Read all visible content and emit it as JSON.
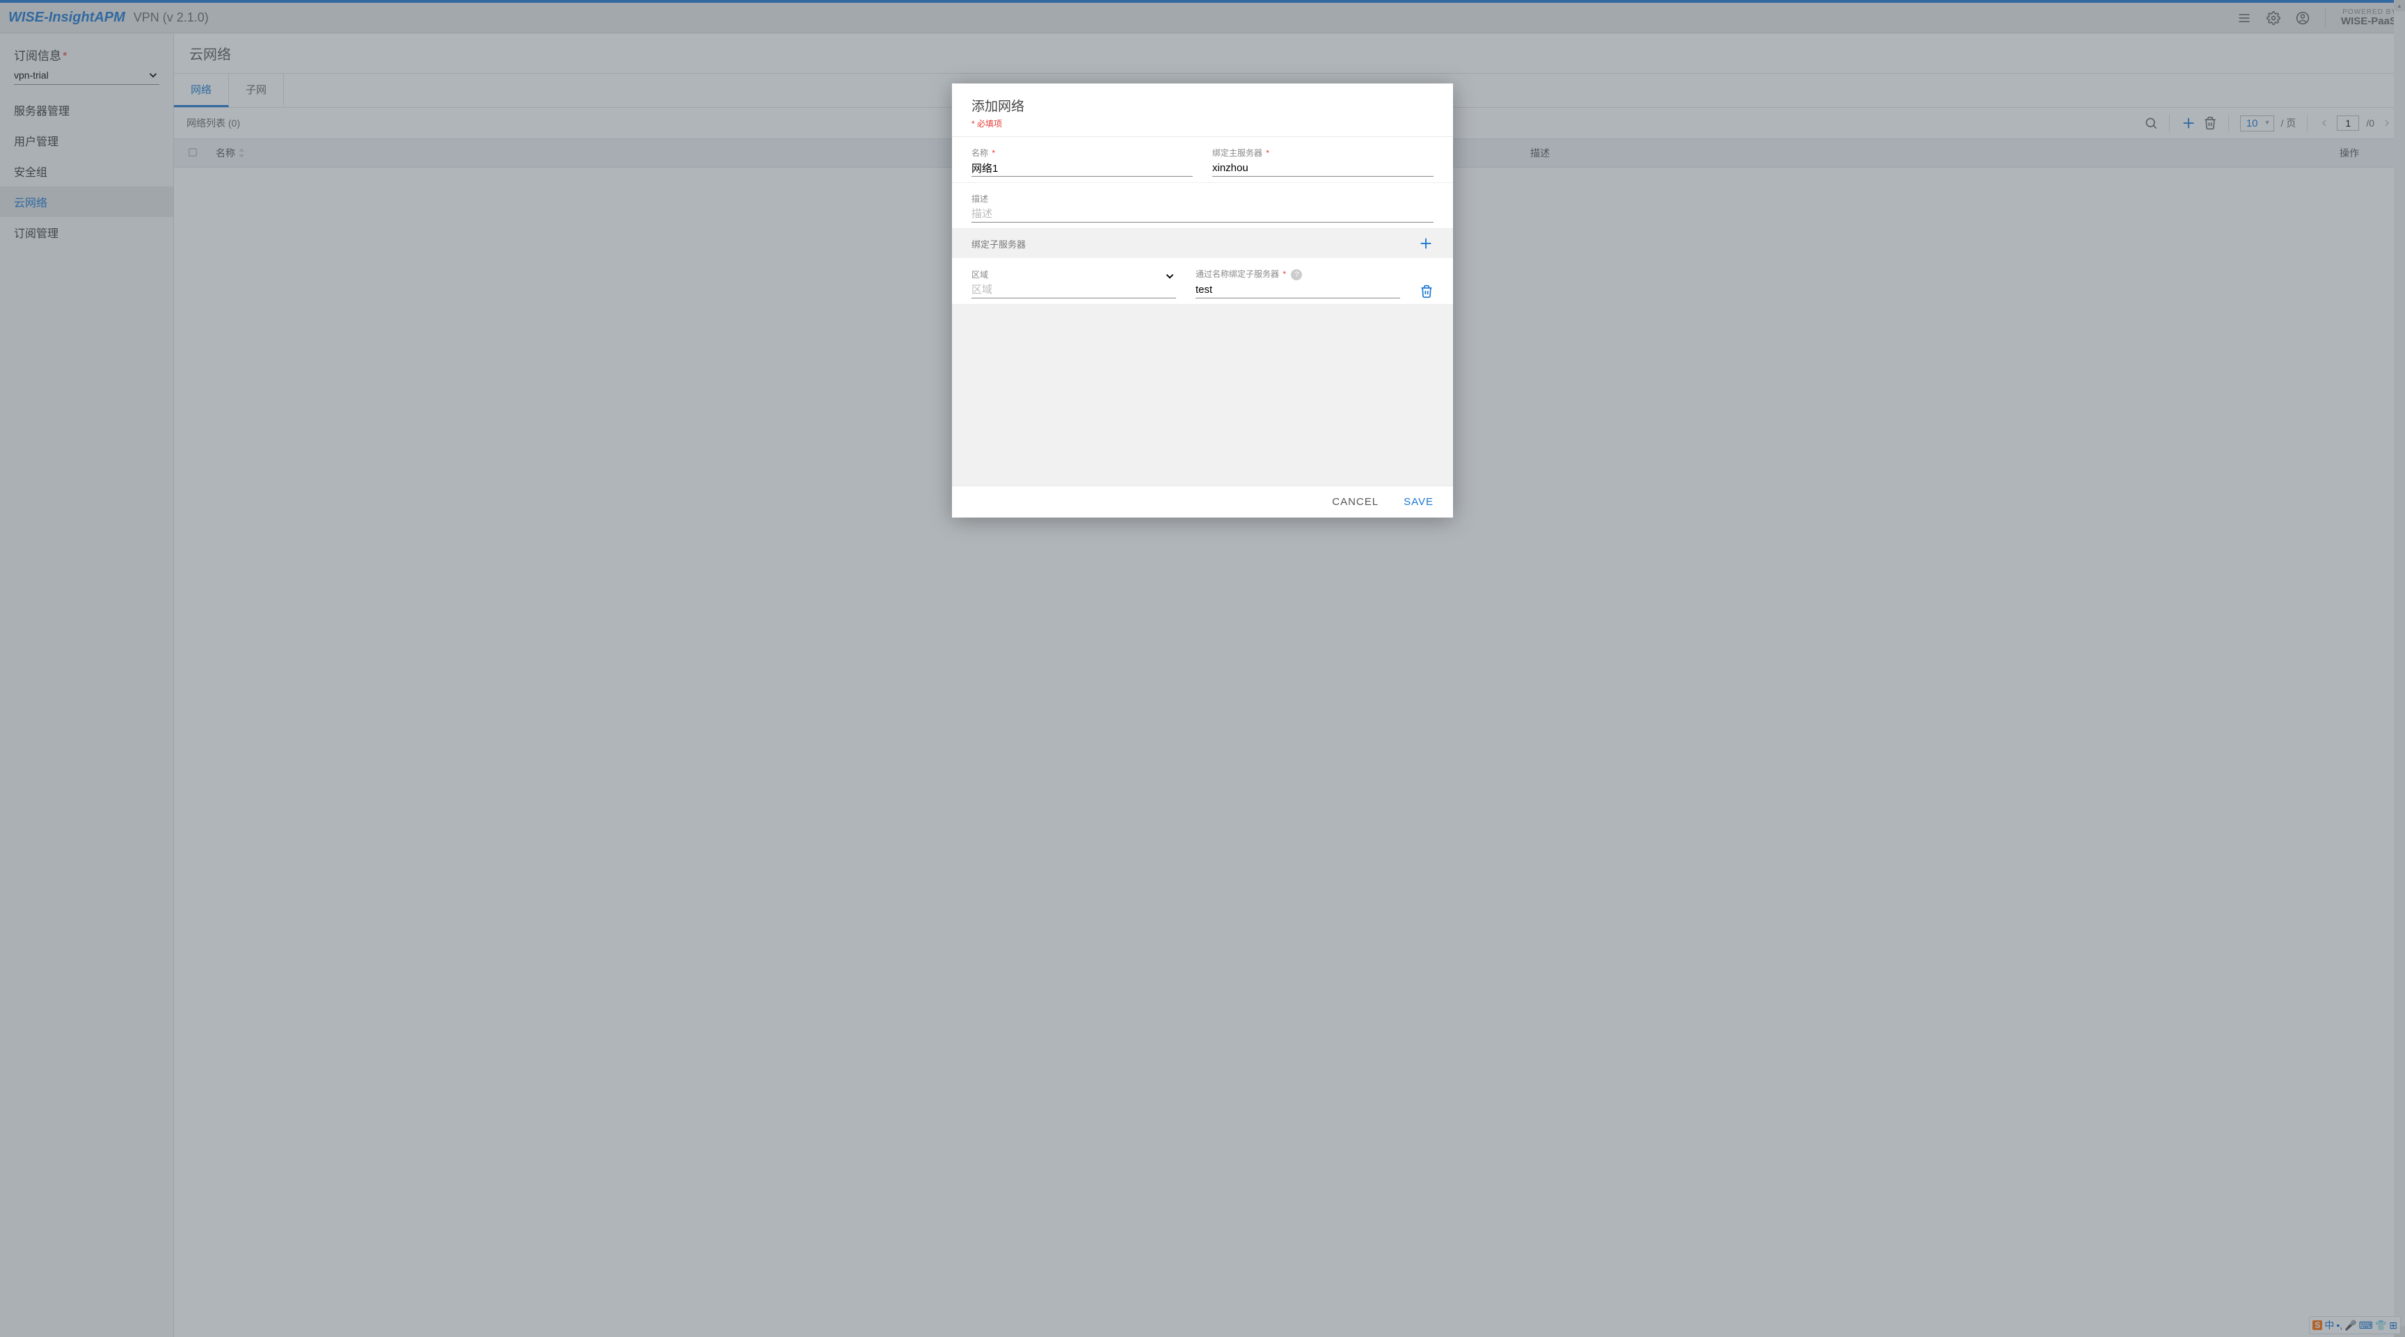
{
  "header": {
    "brand": "WISE-InsightAPM",
    "app": "VPN (v 2.1.0)",
    "powered_top": "POWERED BY",
    "powered_bottom": "WISE-PaaS"
  },
  "sidebar": {
    "sub_label": "订阅信息",
    "sub_value": "vpn-trial",
    "items": [
      "服务器管理",
      "用户管理",
      "安全组",
      "云网络",
      "订阅管理"
    ],
    "active_index": 3
  },
  "page": {
    "title": "云网络",
    "tabs": [
      "网络",
      "子网"
    ],
    "active_tab": 0,
    "list_label": "网络列表 (0)",
    "per_page": "10",
    "per_page_suffix": "/ 页",
    "page_current": "1",
    "page_total": "/0",
    "columns": {
      "name": "名称",
      "desc": "描述",
      "op": "操作"
    }
  },
  "dialog": {
    "title": "添加网络",
    "required_hint": "* 必填项",
    "fields": {
      "name_label": "名称",
      "name_value": "网络1",
      "bind_main_label": "绑定主服务器",
      "bind_main_value": "xinzhou",
      "desc_label": "描述",
      "desc_placeholder": "描述",
      "sub_section": "绑定子服务器",
      "region_label": "区域",
      "region_placeholder": "区域",
      "bind_sub_label": "通过名称绑定子服务器",
      "bind_sub_value": "test"
    },
    "buttons": {
      "cancel": "CANCEL",
      "save": "SAVE"
    }
  },
  "ime": {
    "s": "S",
    "lang": "中"
  }
}
